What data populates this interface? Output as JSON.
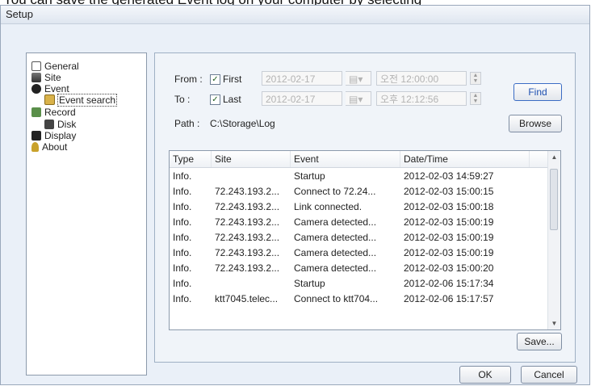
{
  "caption": "You can save the generated Event log on your computer by selecting",
  "window": {
    "title": "Setup"
  },
  "tree": [
    {
      "label": "General",
      "icon": "general-icon"
    },
    {
      "label": "Site",
      "icon": "site-icon"
    },
    {
      "label": "Event",
      "icon": "event-icon"
    },
    {
      "label": "Event search",
      "icon": "event-search-icon"
    },
    {
      "label": "Record",
      "icon": "record-icon"
    },
    {
      "label": "Disk",
      "icon": "disk-icon"
    },
    {
      "label": "Display",
      "icon": "display-icon"
    },
    {
      "label": "About",
      "icon": "about-icon"
    }
  ],
  "search": {
    "from_label": "From :",
    "from_check_label": "First",
    "from_date": "2012-02-17",
    "from_time": "오전 12:00:00",
    "to_label": "To   :",
    "to_check_label": "Last",
    "to_date": "2012-02-17",
    "to_time": "오후 12:12:56",
    "path_label": "Path :",
    "path_value": "C:\\Storage\\Log",
    "find_label": "Find",
    "browse_label": "Browse"
  },
  "log": {
    "columns": [
      "Type",
      "Site",
      "Event",
      "Date/Time"
    ],
    "rows": [
      {
        "type": "Info.",
        "site": "",
        "event": "Startup",
        "datetime": "2012-02-03 14:59:27"
      },
      {
        "type": "Info.",
        "site": "72.243.193.2...",
        "event": "Connect to 72.24...",
        "datetime": "2012-02-03 15:00:15"
      },
      {
        "type": "Info.",
        "site": "72.243.193.2...",
        "event": "Link connected.",
        "datetime": "2012-02-03 15:00:18"
      },
      {
        "type": "Info.",
        "site": "72.243.193.2...",
        "event": "Camera detected...",
        "datetime": "2012-02-03 15:00:19"
      },
      {
        "type": "Info.",
        "site": "72.243.193.2...",
        "event": "Camera detected...",
        "datetime": "2012-02-03 15:00:19"
      },
      {
        "type": "Info.",
        "site": "72.243.193.2...",
        "event": "Camera detected...",
        "datetime": "2012-02-03 15:00:19"
      },
      {
        "type": "Info.",
        "site": "72.243.193.2...",
        "event": "Camera detected...",
        "datetime": "2012-02-03 15:00:20"
      },
      {
        "type": "Info.",
        "site": "",
        "event": "Startup",
        "datetime": "2012-02-06 15:17:34"
      },
      {
        "type": "Info.",
        "site": "ktt7045.telec...",
        "event": "Connect to ktt704...",
        "datetime": "2012-02-06 15:17:57"
      }
    ]
  },
  "save_label": "Save...",
  "ok_label": "OK",
  "cancel_label": "Cancel",
  "colors": {
    "accent": "#1d4fb0",
    "background": "#eaf0f8"
  }
}
